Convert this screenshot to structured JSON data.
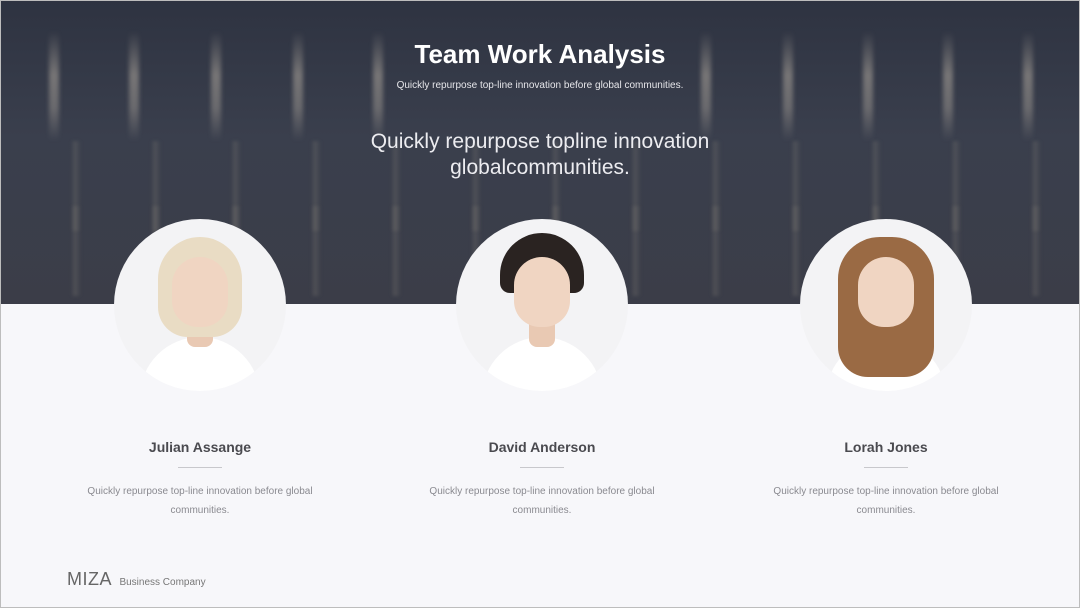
{
  "header": {
    "title": "Team Work Analysis",
    "subtitle": "Quickly repurpose top-line innovation before global communities.",
    "quote_line1": "Quickly repurpose topline innovation",
    "quote_line2": "globalcommunities."
  },
  "team": [
    {
      "name": "Julian Assange",
      "description": "Quickly repurpose top-line innovation before global communities.",
      "hair_color": "#e9dcc4"
    },
    {
      "name": "David Anderson",
      "description": "Quickly repurpose top-line innovation before global communities.",
      "hair_color": "#2a2321"
    },
    {
      "name": "Lorah Jones",
      "description": "Quickly repurpose top-line innovation before global communities.",
      "hair_color": "#9a6a44"
    }
  ],
  "footer": {
    "brand": "MIZA",
    "tagline": "Business Company"
  }
}
